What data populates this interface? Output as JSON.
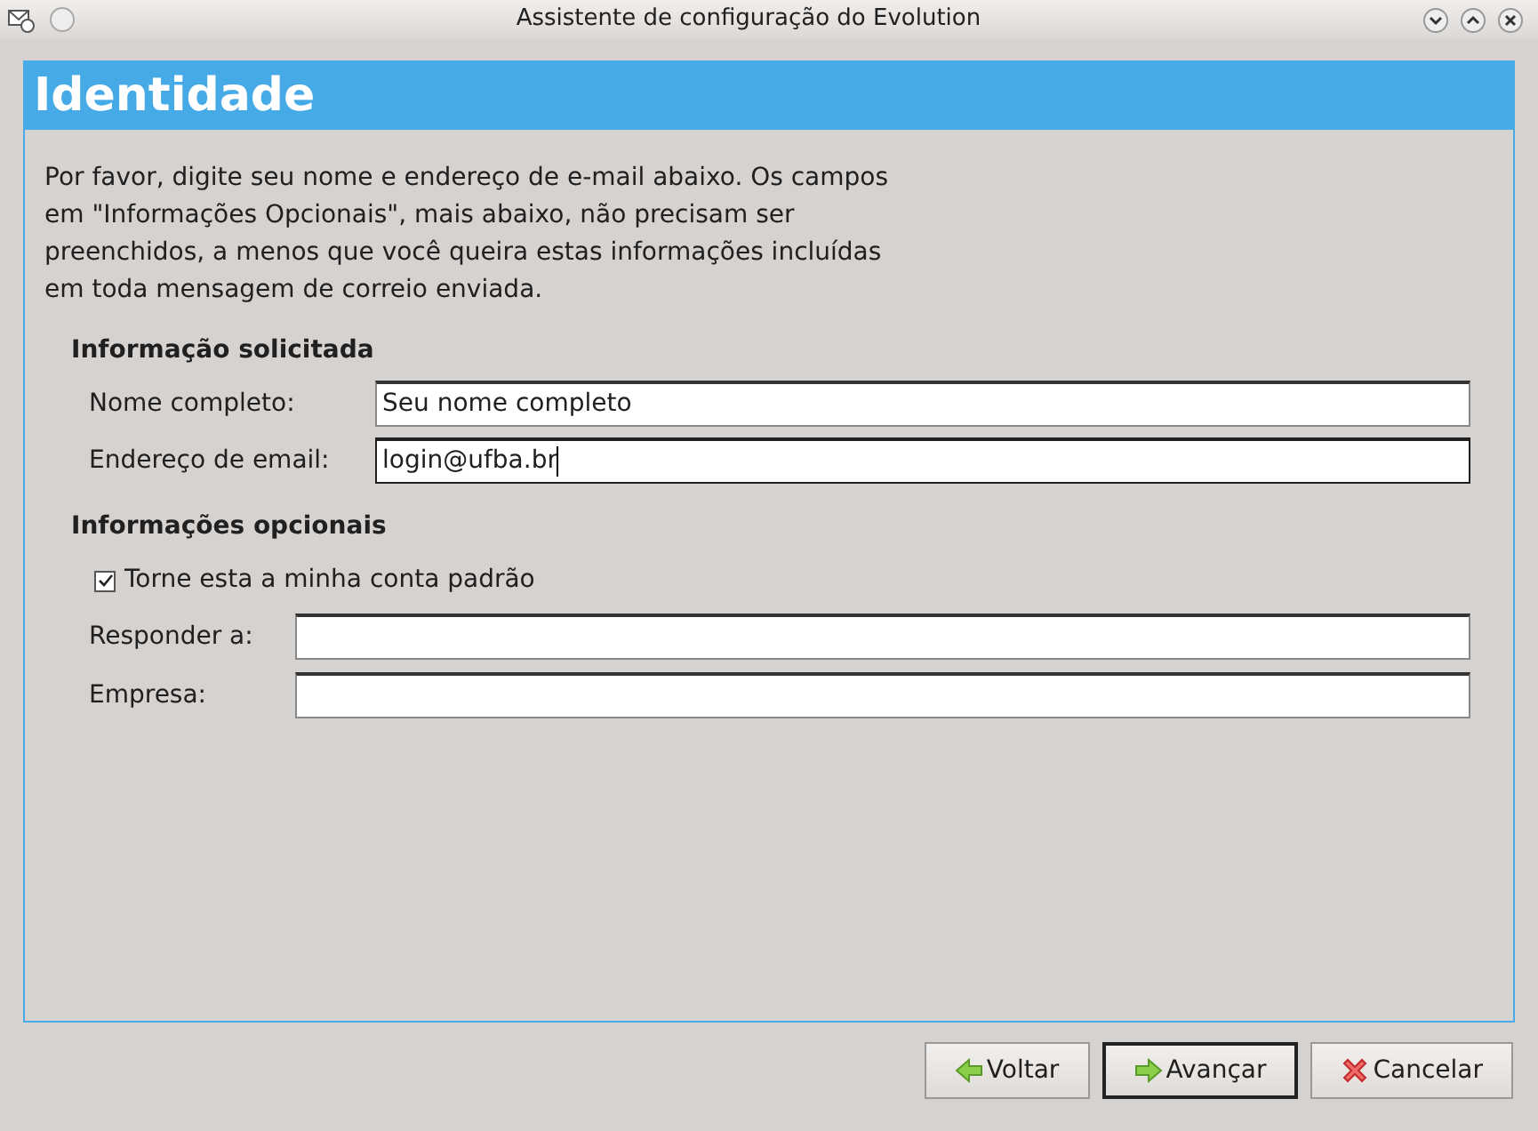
{
  "window": {
    "title": "Assistente de configuração do Evolution"
  },
  "header": {
    "title": "Identidade"
  },
  "description": "Por favor, digite seu nome e endereço de e-mail abaixo. Os campos em \"Informações Opcionais\", mais abaixo, não precisam ser preenchidos, a menos que você queira estas informações incluídas em toda mensagem de correio enviada.",
  "required_section": {
    "title": "Informação solicitada",
    "fields": [
      {
        "label": "Nome completo:",
        "value": "Seu nome completo",
        "focused": false
      },
      {
        "label": "Endereço de email:",
        "value": "login@ufba.br",
        "focused": true
      }
    ]
  },
  "optional_section": {
    "title": "Informações opcionais",
    "checkbox": {
      "label": "Torne esta a minha conta padrão",
      "checked": true
    },
    "fields": [
      {
        "label": "Responder a:"
      },
      {
        "label": "Empresa:"
      }
    ]
  },
  "buttons": [
    {
      "label": "Voltar",
      "kind": "back",
      "default": false
    },
    {
      "label": "Avançar",
      "kind": "next",
      "default": true
    },
    {
      "label": "Cancelar",
      "kind": "cancel",
      "default": false
    }
  ]
}
